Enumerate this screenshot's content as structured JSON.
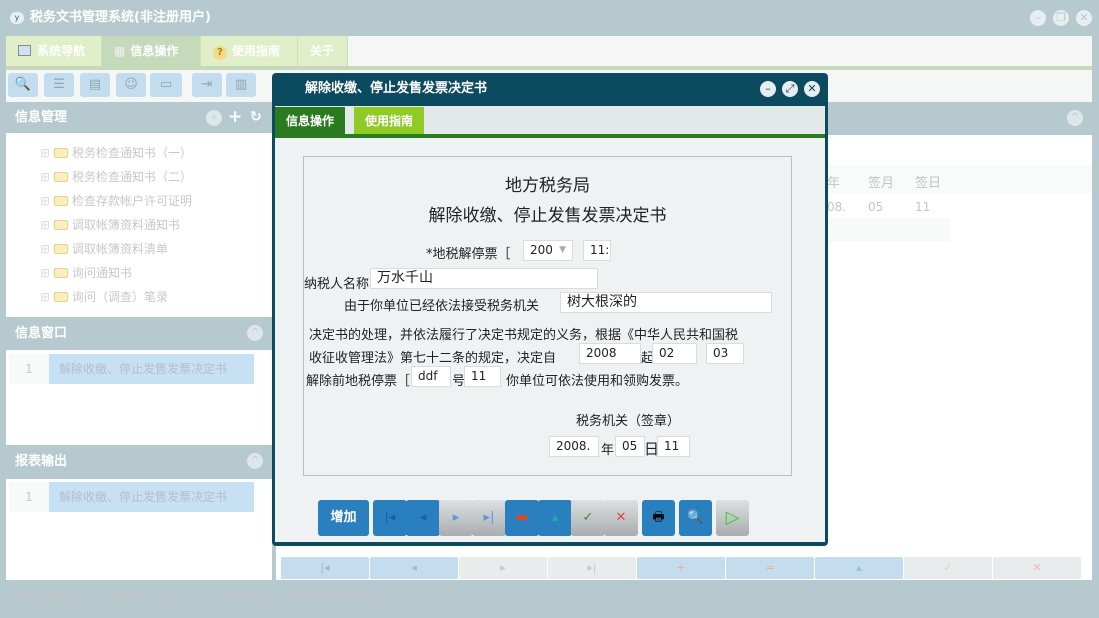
{
  "app": {
    "title": "税务文书管理系统(非注册用户)",
    "window_buttons": [
      "minimize",
      "restore",
      "close"
    ]
  },
  "tabs": [
    {
      "label": "系统导航",
      "icon": "window-icon"
    },
    {
      "label": "信息操作",
      "icon": "grid-icon"
    },
    {
      "label": "使用指南",
      "icon": "help-icon"
    },
    {
      "label": "关于"
    }
  ],
  "toolbar_icons": [
    "search-icon",
    "list-icon",
    "document-icon",
    "user-icon",
    "monitor-icon",
    "export-icon",
    "print-icon"
  ],
  "left": {
    "info_manage": {
      "title": "信息管理",
      "tree": [
        "税务检查通知书（一）",
        "税务检查通知书（二）",
        "检查存款帐户许可证明",
        "调取帐簿资料通知书",
        "调取帐簿资料清单",
        "询问通知书",
        "询问（调查）笔录"
      ]
    },
    "info_window": {
      "title": "信息窗口",
      "rows": [
        {
          "no": "1",
          "name": "解除收缴、停止发售发票决定书"
        }
      ]
    },
    "report": {
      "title": "报表输出",
      "rows": [
        {
          "no": "1",
          "name": "解除收缴、停止发售发票决定书"
        }
      ]
    }
  },
  "grid": {
    "columns": [
      "年",
      "签月",
      "签日"
    ],
    "row": [
      "08.",
      "05",
      "11"
    ]
  },
  "nav_buttons": [
    "first",
    "prev",
    "next",
    "last",
    "add",
    "delete",
    "up",
    "confirm",
    "cancel"
  ],
  "status": {
    "count": "当前记录数 1",
    "operator": "操作者:Admin",
    "note": "本系统支持二次开发和全新开发!"
  },
  "dialog": {
    "title": "解除收缴、停止发售发票决定书",
    "tabs": [
      "信息操作",
      "使用指南"
    ],
    "form": {
      "title1": "地方税务局",
      "title2": "解除收缴、停止发售发票决定书",
      "l_no": "*地税解停票［",
      "year_select": "200",
      "no_value": "11:",
      "l_taxpayer": "纳税人名称",
      "taxpayer": "万水千山",
      "l_reason": "由于你单位已经依法接受税务机关",
      "authority": "树大根深的",
      "p1": "决定书的处理，并依法履行了决定书规定的义务，根据《中华人民共和国税",
      "p2": "收征收管理法》第七十二条的规定，决定自",
      "from_year": "2008",
      "l_qi": "起",
      "from_month": "02",
      "from_day": "03",
      "p3": "解除前地税停票［",
      "ref_a": "ddf",
      "l_hao": "号",
      "ref_b": "11",
      "p4": "你单位可依法使用和领购发票。",
      "sign": "税务机关（签章）",
      "sign_year": "2008.",
      "l_year": "年",
      "sign_month": "05",
      "l_day": "日",
      "sign_day": "11"
    },
    "buttons": {
      "add": "增加"
    }
  }
}
